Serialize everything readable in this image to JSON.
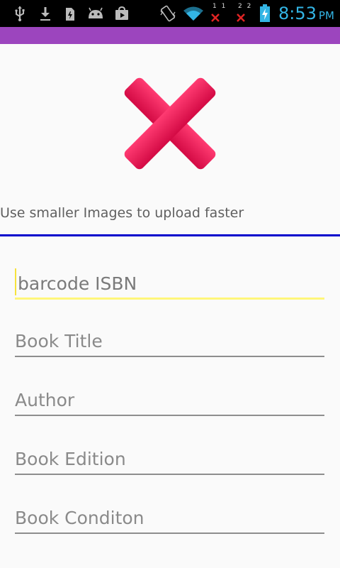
{
  "status_bar": {
    "time": "8:53",
    "ampm": "PM",
    "signal_1": "1 1",
    "signal_2": "2 2",
    "icons": [
      "usb-icon",
      "download-icon",
      "sim-icon",
      "android-icon",
      "store-icon",
      "vibrate-icon",
      "wifi-icon",
      "no-signal-icon",
      "no-signal-icon",
      "battery-charging-icon"
    ],
    "time_color": "#33b5e5"
  },
  "app_bar": {
    "color": "#9c45be"
  },
  "image": {
    "icon": "close-x-icon",
    "color": "#e0174f"
  },
  "hint": "Use smaller Images to upload faster",
  "fields": [
    {
      "placeholder": "barcode ISBN",
      "focused": true
    },
    {
      "placeholder": "Book Title",
      "focused": false
    },
    {
      "placeholder": "Author",
      "focused": false
    },
    {
      "placeholder": "Book Edition",
      "focused": false
    },
    {
      "placeholder": "Book Conditon",
      "focused": false
    }
  ]
}
